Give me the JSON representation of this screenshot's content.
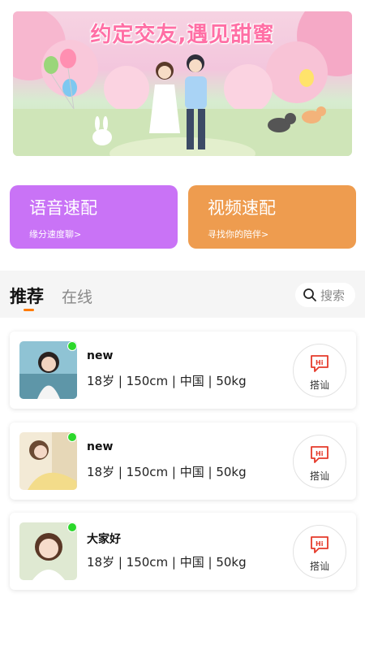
{
  "banner": {
    "title": "约定交友,遇见甜蜜"
  },
  "quick_match": {
    "voice": {
      "title": "语音速配",
      "subtitle": "缘分速度聊>"
    },
    "video": {
      "title": "视频速配",
      "subtitle": "寻找你的陪伴>"
    }
  },
  "tabs": {
    "recommend": "推荐",
    "online": "在线"
  },
  "search": {
    "label": "搜索",
    "icon": "search-icon"
  },
  "users": [
    {
      "name": "new",
      "info": "18岁 | 150cm | 中国 | 50kg",
      "online": true,
      "greet_label": "搭讪"
    },
    {
      "name": "new",
      "info": "18岁 | 150cm | 中国 | 50kg",
      "online": true,
      "greet_label": "搭讪"
    },
    {
      "name": "大家好",
      "info": "18岁 | 150cm | 中国 | 50kg",
      "online": true,
      "greet_label": "搭讪"
    }
  ],
  "colors": {
    "voice_card": "#c973f6",
    "video_card": "#ee9c4f",
    "accent": "#ff7a00",
    "online": "#2bd82b",
    "greet_icon": "#e53a2a"
  }
}
